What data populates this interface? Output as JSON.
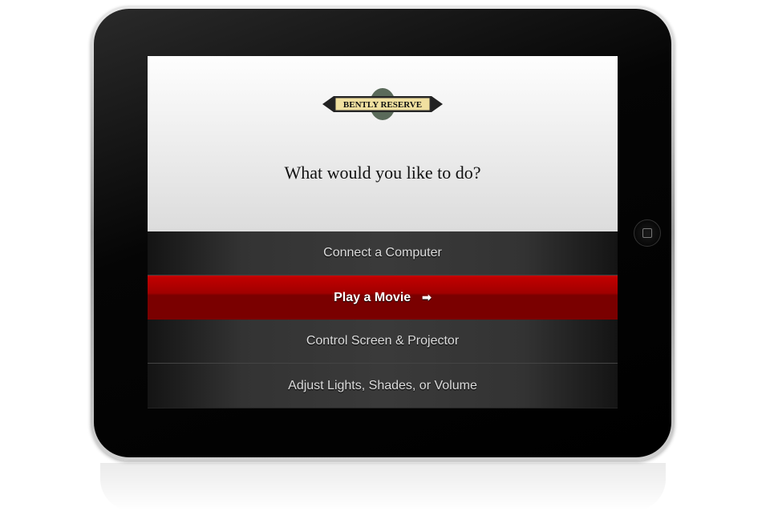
{
  "logo": {
    "text": "BENTLY RESERVE"
  },
  "header": {
    "title": "What would you like to do?"
  },
  "menu": {
    "items": [
      {
        "label": "Connect a Computer"
      },
      {
        "label": "Play a Movie",
        "selected": true
      },
      {
        "label": "Control Screen & Projector"
      },
      {
        "label": "Adjust Lights, Shades, or Volume"
      }
    ]
  },
  "colors": {
    "accent": "#b00000"
  }
}
